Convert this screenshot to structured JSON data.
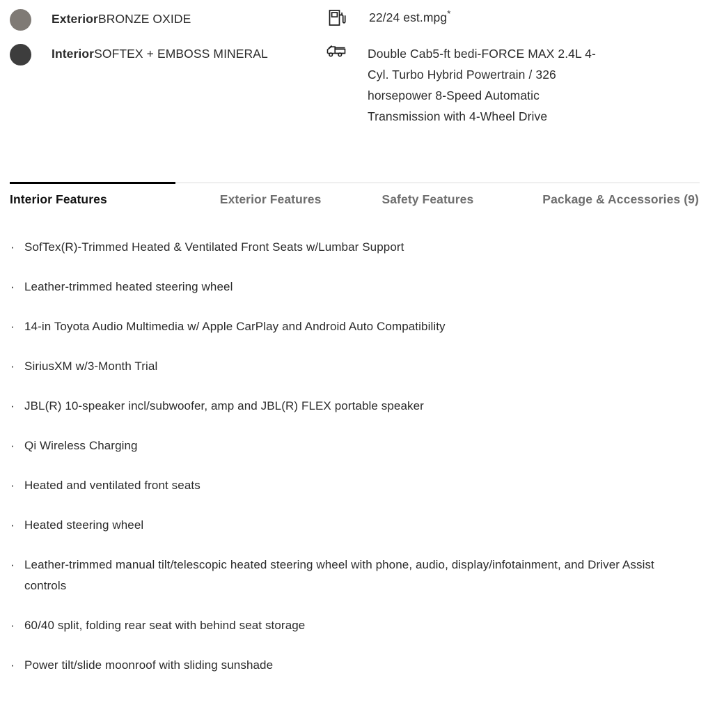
{
  "vehicle_specs": {
    "exterior": {
      "label": "Exterior",
      "value": "BRONZE OXIDE",
      "swatch_color": "#7f7a75",
      "icon": "color-swatch-circle-icon"
    },
    "interior": {
      "label": "Interior",
      "value": "SOFTEX + EMBOSS MINERAL",
      "swatch_color": "#3d3d3d",
      "icon": "color-swatch-circle-icon"
    },
    "fuel_economy": {
      "icon": "fuel-pump-icon",
      "value": "22/24 est.mpg",
      "footnote_marker": "*"
    },
    "powertrain": {
      "icon": "pickup-truck-icon",
      "value": "Double Cab5-ft bedi-FORCE MAX 2.4L 4-Cyl. Turbo Hybrid Powertrain  / 326 horsepower 8-Speed Automatic Transmission with 4-Wheel Drive"
    }
  },
  "tabs": {
    "active_index": 0,
    "items": [
      {
        "label": "Interior Features",
        "active": true
      },
      {
        "label": "Exterior Features",
        "active": false
      },
      {
        "label": "Safety Features",
        "active": false
      },
      {
        "label": "Package & Accessories (9)",
        "active": false
      }
    ],
    "next_icon": "chevron-right-icon",
    "active_underline_color": "#000000",
    "inactive_color": "#6e6e6e",
    "active_color": "#111111"
  },
  "features": {
    "bullet": "·",
    "items": [
      "SofTex(R)-Trimmed Heated & Ventilated Front Seats w/Lumbar Support",
      "Leather-trimmed heated steering wheel",
      "14-in Toyota Audio Multimedia w/ Apple CarPlay and Android Auto Compatibility",
      "SiriusXM w/3-Month Trial",
      "JBL(R) 10-speaker incl/subwoofer, amp and JBL(R) FLEX portable speaker",
      "Qi Wireless Charging",
      "Heated and ventilated front seats",
      "Heated steering wheel",
      "Leather-trimmed manual tilt/telescopic heated steering wheel with phone, audio, display/infotainment, and Driver Assist controls",
      "60/40 split, folding rear seat with behind seat storage",
      "Power tilt/slide moonroof with sliding sunshade"
    ]
  }
}
